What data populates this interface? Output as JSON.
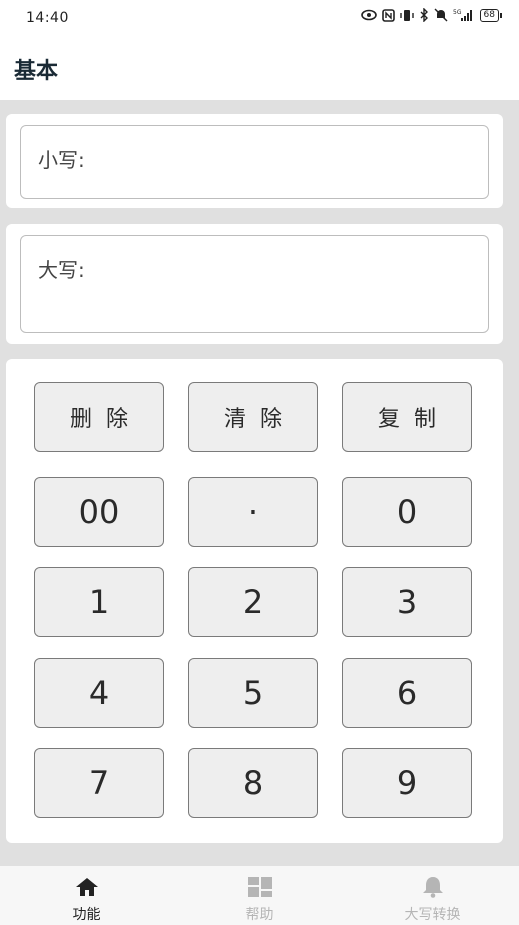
{
  "status": {
    "time": "14:40",
    "icons": [
      "eye-icon",
      "nfc-icon",
      "vibrate-icon",
      "bluetooth-icon",
      "mute-icon",
      "signal-5g-icon"
    ],
    "battery": "68"
  },
  "app_bar": {
    "title": "基本"
  },
  "lowercase": {
    "label": "小写:"
  },
  "uppercase": {
    "label": "大写:"
  },
  "keypad": {
    "delete": "删除",
    "clear": "清除",
    "copy": "复制",
    "k00": "00",
    "dot": "·",
    "k0": "0",
    "k1": "1",
    "k2": "2",
    "k3": "3",
    "k4": "4",
    "k5": "5",
    "k6": "6",
    "k7": "7",
    "k8": "8",
    "k9": "9"
  },
  "nav": {
    "items": [
      {
        "label": "功能",
        "icon": "home-icon",
        "active": true
      },
      {
        "label": "帮助",
        "icon": "grid-icon",
        "active": false
      },
      {
        "label": "大写转换",
        "icon": "bell-icon",
        "active": false
      }
    ],
    "active_color": "#222222",
    "inactive_color": "#b5b5b5"
  }
}
